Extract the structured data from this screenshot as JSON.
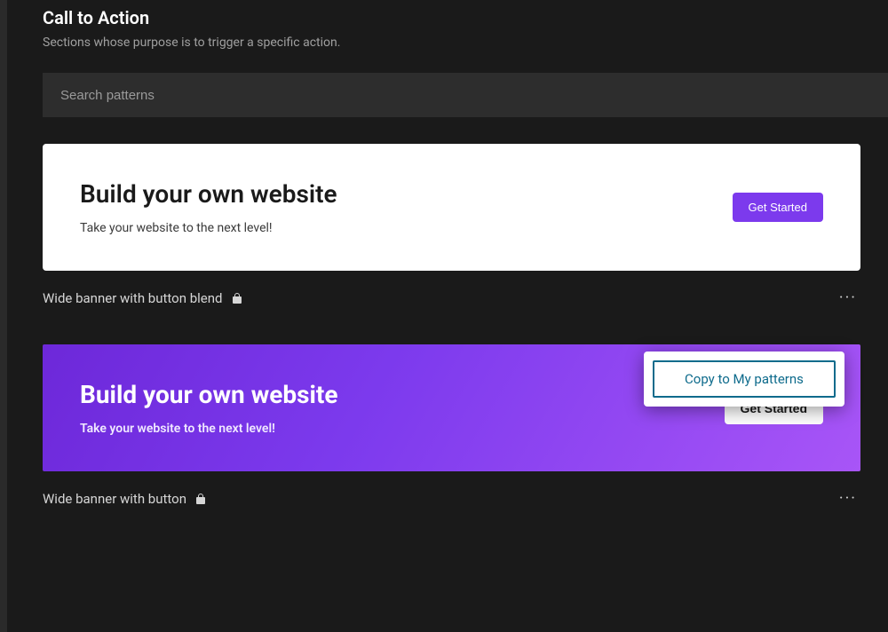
{
  "header": {
    "title": "Call to Action",
    "subtitle": "Sections whose purpose is to trigger a specific action."
  },
  "search": {
    "placeholder": "Search patterns"
  },
  "patterns": [
    {
      "title": "Build your own website",
      "subtext": "Take your website to the next level!",
      "cta": "Get Started",
      "label": "Wide banner with button blend"
    },
    {
      "title": "Build your own website",
      "subtext": "Take your website to the next level!",
      "cta": "Get Started",
      "label": "Wide banner with button"
    }
  ],
  "contextMenu": {
    "copy": "Copy to My patterns"
  }
}
